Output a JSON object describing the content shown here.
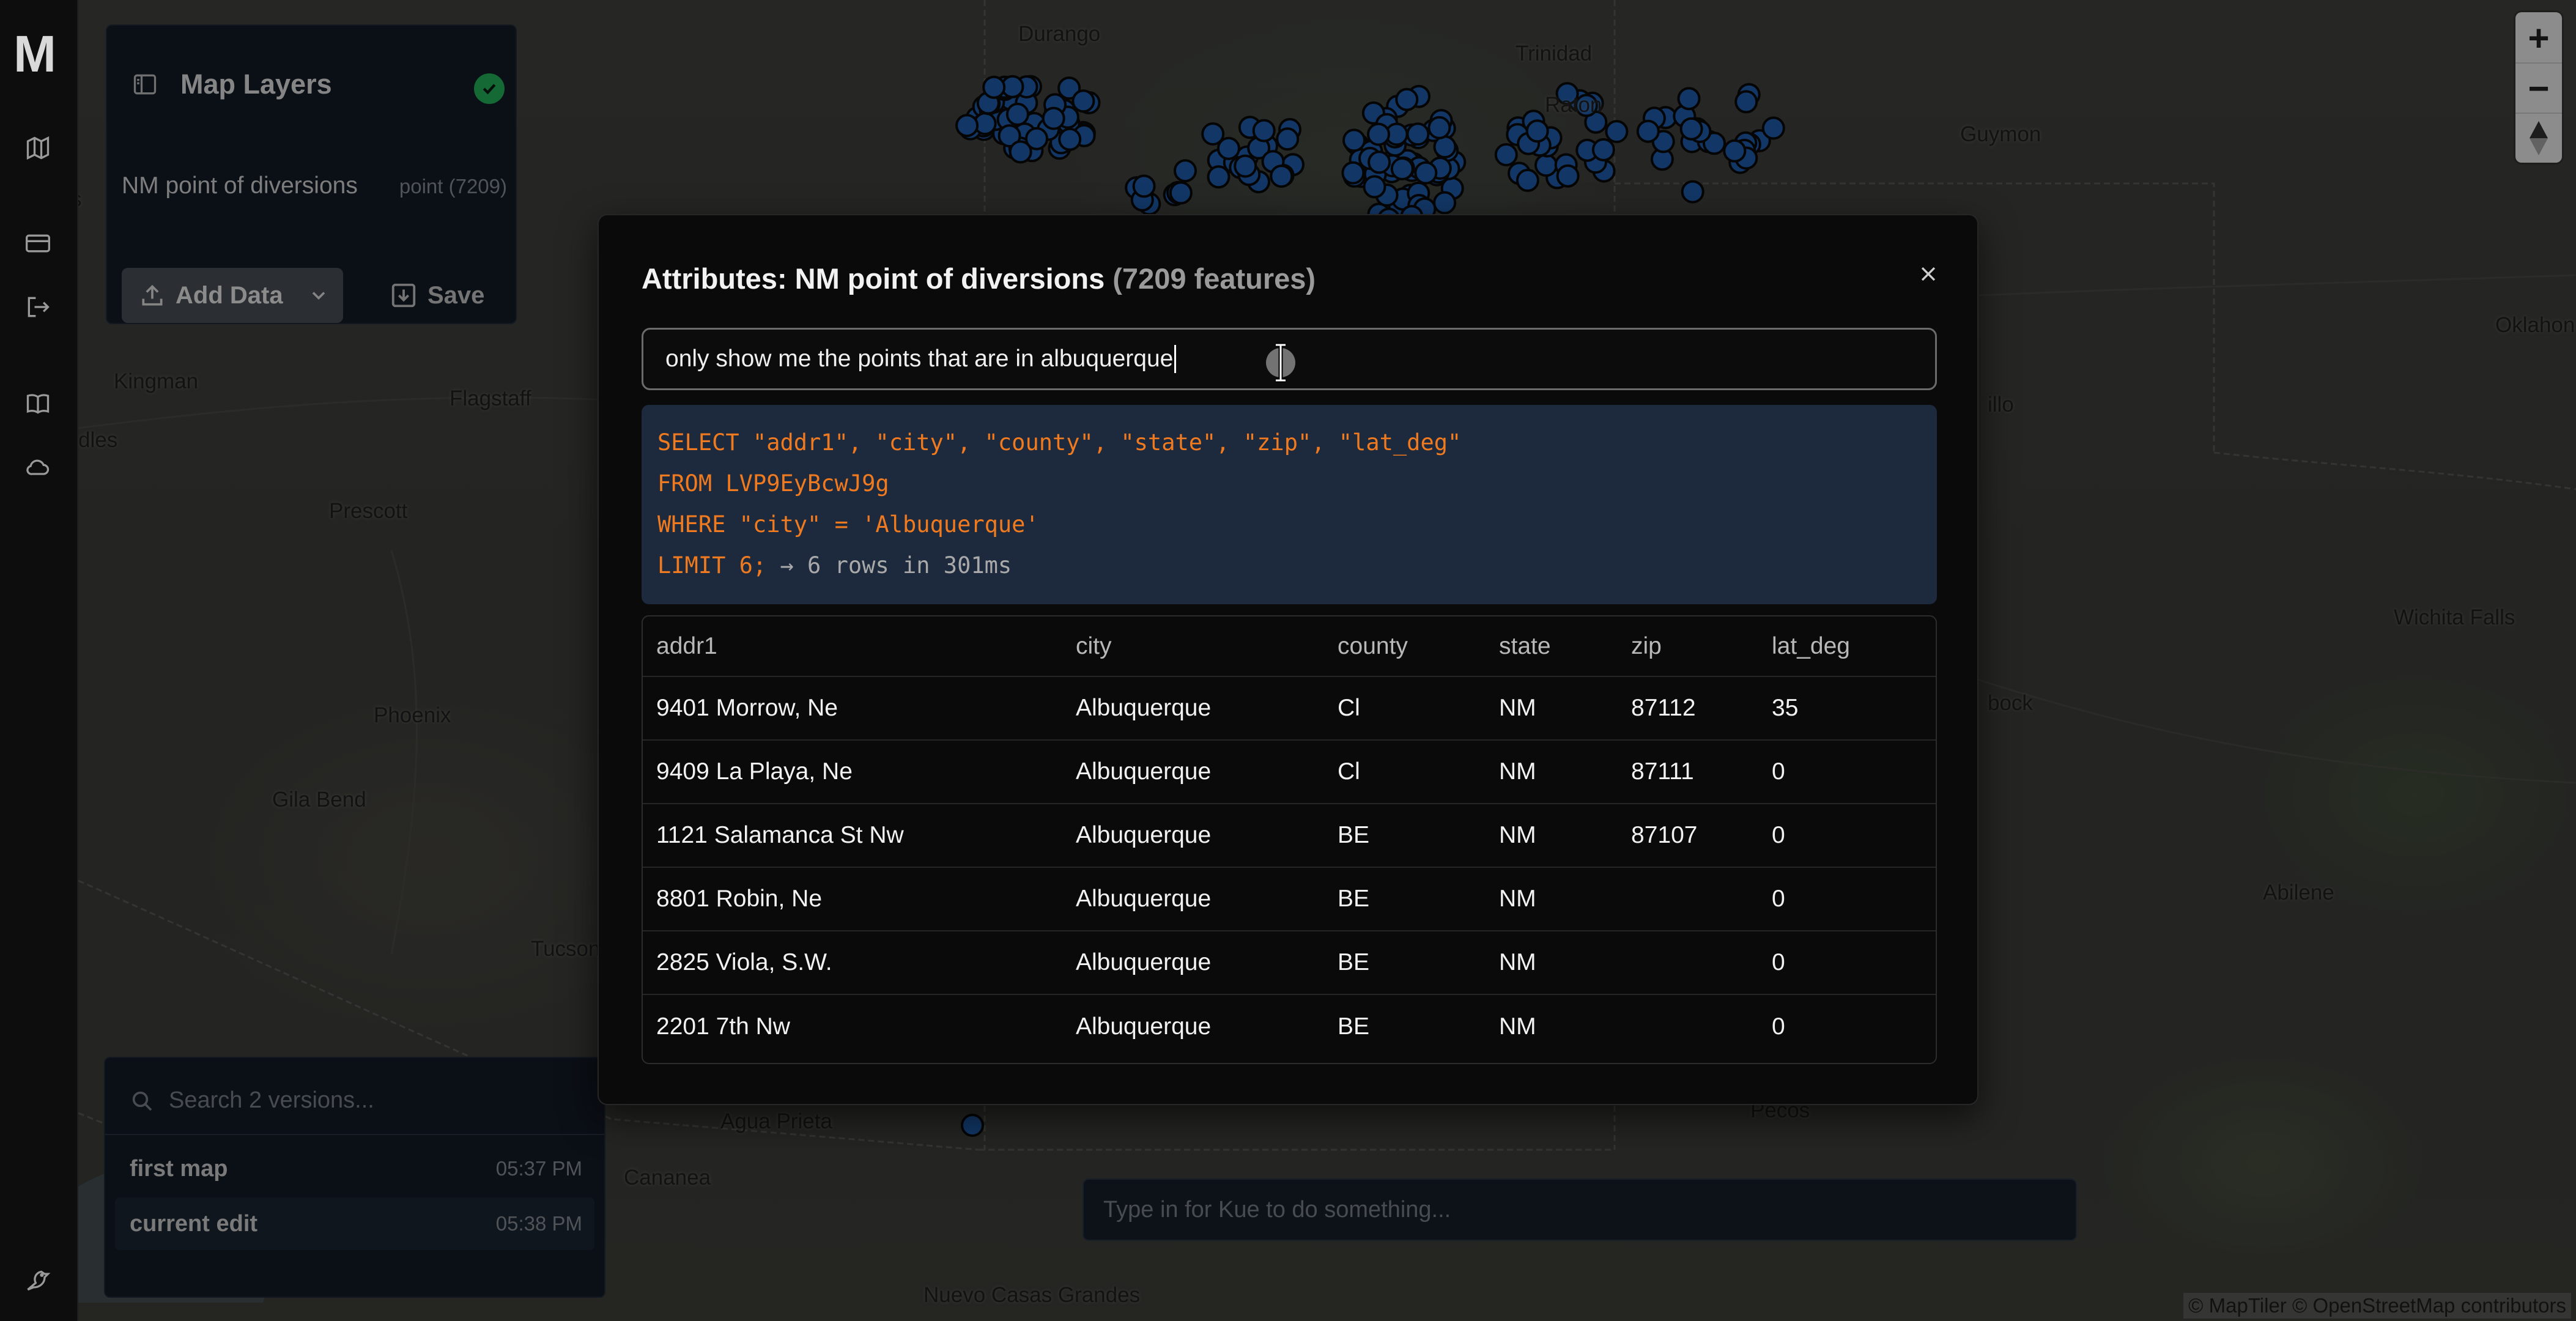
{
  "app": {
    "logo": "M"
  },
  "rail": {
    "icons": [
      "map-icon",
      "card-icon",
      "logout-icon",
      "book-icon",
      "cloud-icon",
      "bird-icon"
    ]
  },
  "layers_panel": {
    "title": "Map Layers",
    "layer": {
      "name": "NM point of diversions",
      "meta": "point (7209)"
    },
    "add_data_label": "Add Data",
    "save_label": "Save"
  },
  "map": {
    "places": [
      "Durango",
      "Trinidad",
      "Raton",
      "Guymon",
      "Oklahon",
      "Kingman",
      "Flagstaff",
      "dles",
      "Prescott",
      "Phoenix",
      "Gila Bend",
      "Tucson",
      "Wichita Falls",
      "Abilene",
      "Pecos",
      "Agua Prieta",
      "Cananea",
      "Nuevo Casas Grandes",
      "illo",
      "bock",
      "s"
    ],
    "attribution": "© MapTiler © OpenStreetMap contributors",
    "marker_color": "#1f5fb0"
  },
  "modal": {
    "title_prefix": "Attributes: NM point of diversions",
    "title_count": "(7209 features)",
    "query": "only show me the points that are in albuquerque",
    "sql": {
      "line1": "SELECT \"addr1\", \"city\", \"county\", \"state\", \"zip\", \"lat_deg\"",
      "line2": "FROM LVP9EyBcwJ9g",
      "line3": "WHERE \"city\" = 'Albuquerque'",
      "line4": "LIMIT 6;",
      "result": " → 6 rows in 301ms"
    },
    "columns": [
      "addr1",
      "city",
      "county",
      "state",
      "zip",
      "lat_deg"
    ],
    "rows": [
      [
        "9401 Morrow, Ne",
        "Albuquerque",
        "Cl",
        "NM",
        "87112",
        "35"
      ],
      [
        "9409 La Playa, Ne",
        "Albuquerque",
        "Cl",
        "NM",
        "87111",
        "0"
      ],
      [
        "1121 Salamanca St Nw",
        "Albuquerque",
        "BE",
        "NM",
        "87107",
        "0"
      ],
      [
        "8801 Robin, Ne",
        "Albuquerque",
        "BE",
        "NM",
        "",
        "0"
      ],
      [
        "2825 Viola, S.W.",
        "Albuquerque",
        "BE",
        "NM",
        "",
        "0"
      ],
      [
        "2201 7th Nw",
        "Albuquerque",
        "BE",
        "NM",
        "",
        "0"
      ]
    ]
  },
  "versions_panel": {
    "search_placeholder": "Search 2 versions...",
    "items": [
      {
        "name": "first map",
        "time": "05:37 PM"
      },
      {
        "name": "current edit",
        "time": "05:38 PM"
      }
    ]
  },
  "command_bar": {
    "placeholder": "Type in for Kue to do something..."
  },
  "zoom": {
    "in": "+",
    "out": "−"
  }
}
